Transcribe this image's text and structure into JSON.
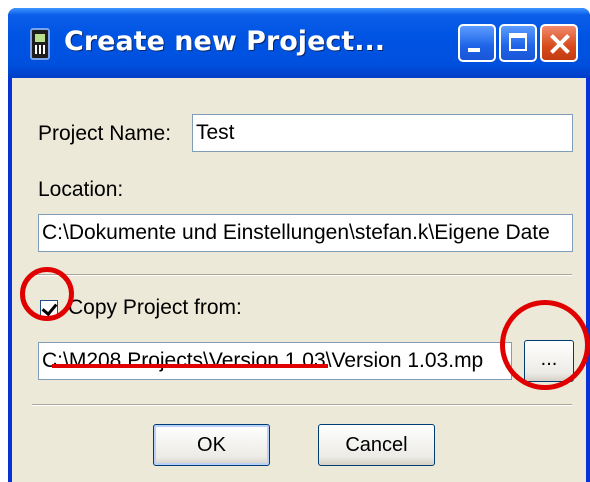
{
  "window": {
    "title": "Create new Project...",
    "app_icon": "mobile-phone-icon",
    "controls": [
      "minimize-icon",
      "maximize-icon",
      "close-icon"
    ]
  },
  "form": {
    "project_name_label": "Project Name:",
    "project_name_value": "Test",
    "location_label": "Location:",
    "location_value": "C:\\Dokumente und Einstellungen\\stefan.k\\Eigene Date",
    "copy_checkbox_checked": true,
    "copy_label": "Copy Project from:",
    "copy_path_value": "C:\\M208 Projects\\Version 1.03\\Version 1.03.mp",
    "browse_label": "..."
  },
  "buttons": {
    "ok_label": "OK",
    "cancel_label": "Cancel"
  },
  "annotations": {
    "color": "#e00000",
    "marks": [
      "checkbox-highlight-circle",
      "path-underline",
      "browse-button-highlight-circle"
    ]
  },
  "colors": {
    "titlebar": "#0054e3",
    "frame": "#0831d9",
    "dialog_face": "#ece9d8",
    "close_button": "#d84a1c"
  }
}
